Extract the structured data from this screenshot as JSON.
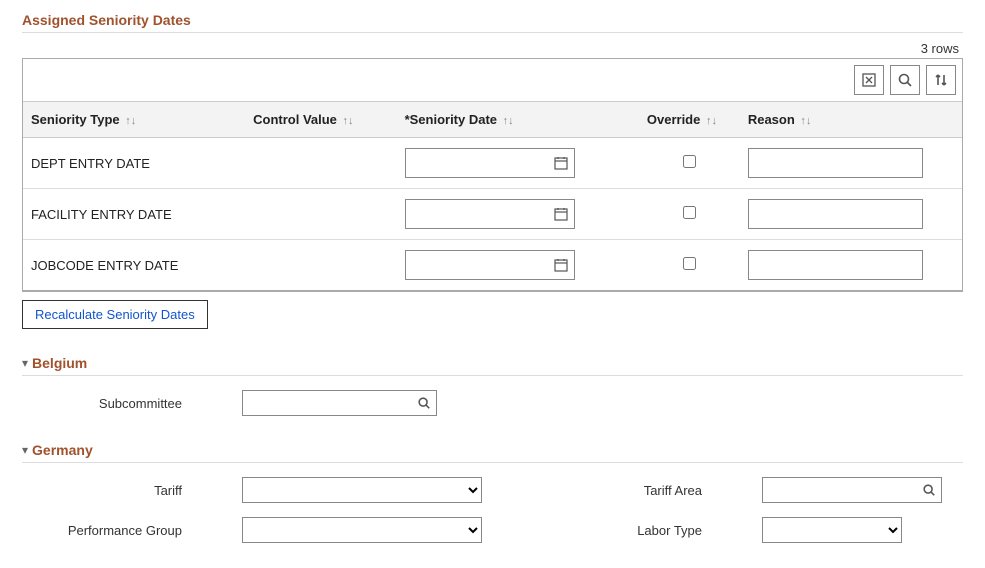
{
  "section_title": "Assigned Seniority Dates",
  "rows_info": "3 rows",
  "toolbar_icons": {
    "personalize": "personalize-icon",
    "find": "search-icon",
    "sort": "sort-icon"
  },
  "columns": {
    "seniority_type": "Seniority Type",
    "control_value": "Control Value",
    "seniority_date": "*Seniority Date",
    "override": "Override",
    "reason": "Reason"
  },
  "rows": [
    {
      "seniority_type": "DEPT ENTRY DATE",
      "control_value": "",
      "seniority_date": "",
      "override": false,
      "reason": ""
    },
    {
      "seniority_type": "FACILITY ENTRY DATE",
      "control_value": "",
      "seniority_date": "",
      "override": false,
      "reason": ""
    },
    {
      "seniority_type": "JOBCODE ENTRY DATE",
      "control_value": "",
      "seniority_date": "",
      "override": false,
      "reason": ""
    }
  ],
  "recalculate_label": "Recalculate Seniority Dates",
  "belgium": {
    "title": "Belgium",
    "subcommittee_label": "Subcommittee",
    "subcommittee_value": ""
  },
  "germany": {
    "title": "Germany",
    "tariff_label": "Tariff",
    "tariff_value": "",
    "tariff_area_label": "Tariff Area",
    "tariff_area_value": "",
    "performance_group_label": "Performance Group",
    "performance_group_value": "",
    "labor_type_label": "Labor Type",
    "labor_type_value": ""
  }
}
